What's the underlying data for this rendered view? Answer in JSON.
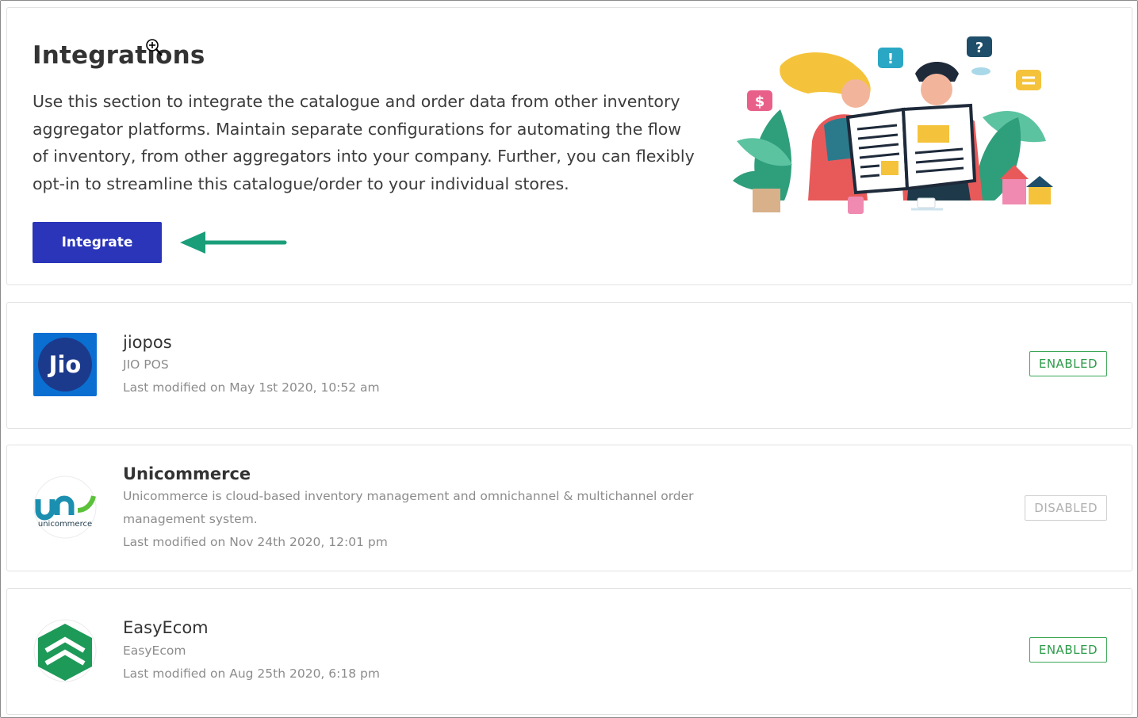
{
  "header": {
    "title": "Integrations",
    "description": "Use this section to integrate the catalogue and order data from other inventory aggregator platforms. Maintain separate configurations for automating the flow of inventory, from other aggregators into your company. Further, you can flexibly opt-in to streamline this catalogue/order to your individual stores.",
    "integrate_label": "Integrate"
  },
  "integrations": [
    {
      "name": "jiopos",
      "subtitle": "JIO POS",
      "modified": "Last modified on May 1st 2020, 10:52 am",
      "status": "ENABLED",
      "logo_text": "Jio"
    },
    {
      "name": "Unicommerce",
      "subtitle": "Unicommerce is cloud-based inventory management and omnichannel & multichannel order management system.",
      "modified": "Last modified on Nov 24th 2020, 12:01 pm",
      "status": "DISABLED",
      "logo_text": "unicommerce"
    },
    {
      "name": "EasyEcom",
      "subtitle": "EasyEcom",
      "modified": "Last modified on Aug 25th 2020, 6:18 pm",
      "status": "ENABLED",
      "logo_text": ""
    }
  ],
  "colors": {
    "primary": "#2b35b9",
    "enabled": "#3aa654",
    "arrow": "#1a9e7a",
    "jio_bg": "#0a6fd1"
  },
  "icons": {
    "cursor": "zoom-cursor-icon",
    "arrow": "arrow-left-icon"
  }
}
